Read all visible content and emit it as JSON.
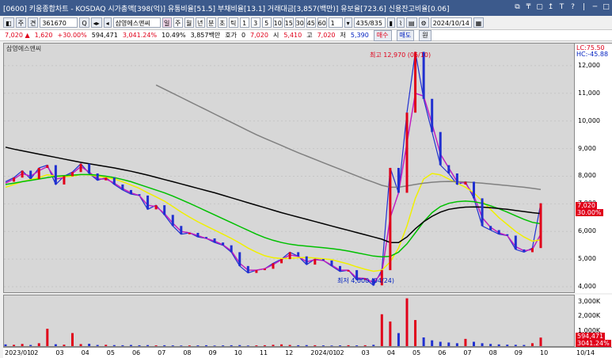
{
  "window": {
    "title": "[0600] 키움종합차트 - KOSDAQ 시가총액[398(억)] 유통비율[51.5] 부채비율[13.1] 거래대금[3,857(백만)] 유보율[723.6] 신용잔고비율[0.06]",
    "controls": [
      "⧉",
      "₸",
      "▢",
      "↥",
      "T",
      "?",
      "|",
      "─",
      "□"
    ]
  },
  "toolbar": {
    "mode": "주",
    "type": "견",
    "code": "361670",
    "stock_name": "삼영에스앤씨",
    "periods": [
      "일",
      "주",
      "월",
      "년",
      "분",
      "초",
      "틱"
    ],
    "period_selected": "일",
    "minute_options": [
      "1",
      "3",
      "5",
      "10",
      "15",
      "30",
      "45",
      "60"
    ],
    "count_value": "1",
    "range": "435/835",
    "date": "2024/10/14"
  },
  "info": {
    "price": "7,020",
    "change": "1,620",
    "change_pct": "+30.00%",
    "volume": "594,471",
    "volume_pct": "3,041.24%",
    "turnover": "10.49%",
    "amount": "3,857백만",
    "quote_label": "호가",
    "quote_value": "0",
    "ask_price": "7,020",
    "open_label": "시",
    "open": "5,410",
    "high_label": "고",
    "high": "7,020",
    "low_label": "저",
    "low": "5,390",
    "buy_button": "매수",
    "sell_button": "매도",
    "extra_button": "원"
  },
  "chart_data": {
    "type": "candlestick",
    "title": "삼영에스앤씨",
    "price_axis": [
      "12,000",
      "11,000",
      "10,000",
      "9,000",
      "8,000",
      "7,000",
      "6,000",
      "5,000",
      "4,000"
    ],
    "ylim": [
      3800,
      12800
    ],
    "x_labels": [
      "2023/01",
      "02",
      "03",
      "04",
      "05",
      "06",
      "07",
      "08",
      "09",
      "10",
      "11",
      "12",
      "2024/01",
      "02",
      "03",
      "04",
      "05",
      "06",
      "07",
      "08",
      "09",
      "10",
      "10/14"
    ],
    "annotations": {
      "high": "최고 12,970 (06/10)",
      "low": "최저 4,000 (04/24)",
      "lc": "LC:75.50",
      "hc": "HC:-45.88",
      "current_price": "7,020",
      "current_pct": "30.00%"
    },
    "series": [
      {
        "name": "close",
        "color": "#2030d0",
        "values": [
          7800,
          7950,
          8200,
          7900,
          8300,
          8400,
          7700,
          8000,
          8150,
          8450,
          8100,
          7850,
          7950,
          7700,
          7500,
          7350,
          7300,
          6800,
          6950,
          6600,
          6200,
          5900,
          5950,
          5800,
          5750,
          5600,
          5500,
          5250,
          4750,
          4500,
          4600,
          4650,
          4850,
          5000,
          5250,
          5100,
          4800,
          5000,
          4950,
          4750,
          4550,
          4600,
          4250,
          4300,
          4050,
          4600,
          8300,
          7400,
          10300,
          12500,
          10800,
          9600,
          8400,
          8100,
          7700,
          7800,
          7200,
          6200,
          6050,
          5900,
          5850,
          5350,
          5250,
          5400,
          7020
        ]
      },
      {
        "name": "ma5",
        "color": "#c020c0",
        "values": [
          7750,
          7900,
          8100,
          8000,
          8200,
          8350,
          7900,
          7950,
          8100,
          8350,
          8150,
          7900,
          7900,
          7750,
          7550,
          7400,
          7300,
          6950,
          6900,
          6650,
          6300,
          6000,
          5950,
          5850,
          5750,
          5650,
          5520,
          5300,
          4850,
          4600,
          4600,
          4650,
          4800,
          4980,
          5150,
          5100,
          4900,
          4980,
          4950,
          4780,
          4600,
          4600,
          4320,
          4300,
          4150,
          4500,
          6500,
          7400,
          9200,
          11000,
          10900,
          9900,
          8800,
          8300,
          7800,
          7750,
          7300,
          6500,
          6150,
          5950,
          5850,
          5450,
          5300,
          5350,
          5900
        ]
      },
      {
        "name": "ma20",
        "color": "#f0f000",
        "values": [
          7600,
          7700,
          7800,
          7880,
          7950,
          8050,
          8000,
          7980,
          8000,
          8060,
          8050,
          8000,
          7950,
          7900,
          7800,
          7680,
          7560,
          7400,
          7250,
          7100,
          6900,
          6700,
          6520,
          6350,
          6200,
          6050,
          5900,
          5750,
          5580,
          5400,
          5250,
          5120,
          5050,
          5020,
          5030,
          5050,
          5060,
          5040,
          5010,
          4980,
          4900,
          4820,
          4720,
          4630,
          4560,
          4600,
          4900,
          5400,
          6200,
          7200,
          7900,
          8100,
          8050,
          7900,
          7750,
          7600,
          7400,
          7100,
          6800,
          6500,
          6250,
          6000,
          5800,
          5650,
          5700
        ]
      },
      {
        "name": "ma60",
        "color": "#00c000",
        "values": [
          7700,
          7750,
          7800,
          7850,
          7900,
          7950,
          8000,
          8020,
          8040,
          8060,
          8060,
          8040,
          8000,
          7950,
          7880,
          7800,
          7700,
          7600,
          7500,
          7400,
          7280,
          7150,
          7020,
          6880,
          6740,
          6600,
          6460,
          6320,
          6180,
          6040,
          5900,
          5780,
          5680,
          5600,
          5540,
          5500,
          5470,
          5440,
          5410,
          5380,
          5340,
          5290,
          5230,
          5170,
          5110,
          5080,
          5100,
          5250,
          5550,
          5950,
          6350,
          6680,
          6900,
          7020,
          7080,
          7100,
          7080,
          7020,
          6930,
          6820,
          6700,
          6570,
          6440,
          6330,
          6280
        ]
      },
      {
        "name": "ma120",
        "color": "#000000",
        "values": [
          9050,
          8980,
          8920,
          8860,
          8800,
          8740,
          8680,
          8620,
          8560,
          8500,
          8450,
          8400,
          8350,
          8300,
          8240,
          8180,
          8110,
          8040,
          7960,
          7880,
          7800,
          7720,
          7640,
          7560,
          7480,
          7400,
          7310,
          7220,
          7130,
          7040,
          6950,
          6860,
          6770,
          6680,
          6600,
          6520,
          6440,
          6360,
          6280,
          6200,
          6120,
          6040,
          5960,
          5880,
          5800,
          5720,
          5600,
          5600,
          5800,
          6100,
          6350,
          6550,
          6700,
          6800,
          6850,
          6880,
          6890,
          6880,
          6860,
          6830,
          6800,
          6760,
          6720,
          6680,
          6650
        ]
      },
      {
        "name": "ma240",
        "color": "#808080",
        "values": [
          null,
          null,
          null,
          null,
          null,
          null,
          null,
          null,
          null,
          null,
          null,
          null,
          null,
          null,
          null,
          null,
          null,
          null,
          11300,
          11150,
          11000,
          10850,
          10700,
          10550,
          10400,
          10250,
          10100,
          9950,
          9800,
          9650,
          9500,
          9370,
          9240,
          9110,
          8980,
          8850,
          8730,
          8610,
          8490,
          8370,
          8250,
          8130,
          8010,
          7890,
          7780,
          7670,
          7600,
          7600,
          7650,
          7700,
          7750,
          7780,
          7800,
          7810,
          7800,
          7790,
          7770,
          7750,
          7720,
          7690,
          7660,
          7630,
          7600,
          7560,
          7520
        ]
      }
    ],
    "volume": {
      "axis": [
        "3,000K",
        "2,000K",
        "1,000K"
      ],
      "current": "594,471",
      "current_pct": "3041.24%",
      "ylim": [
        0,
        3500
      ],
      "values": [
        120,
        90,
        150,
        80,
        200,
        1200,
        130,
        100,
        900,
        140,
        160,
        80,
        90,
        70,
        60,
        80,
        60,
        70,
        50,
        60,
        50,
        40,
        45,
        50,
        60,
        40,
        50,
        60,
        70,
        40,
        50,
        60,
        90,
        120,
        80,
        60,
        70,
        60,
        50,
        40,
        50,
        60,
        50,
        60,
        90,
        2200,
        1700,
        900,
        3300,
        1800,
        600,
        400,
        300,
        250,
        200,
        500,
        300,
        200,
        150,
        120,
        100,
        90,
        80,
        200,
        590
      ]
    }
  }
}
